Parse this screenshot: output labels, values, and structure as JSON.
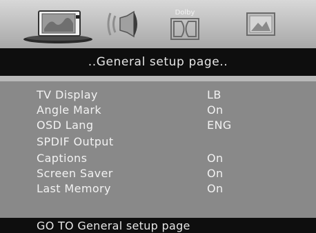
{
  "icons": {
    "setup": "setup-monitor-icon",
    "audio": "speaker-icon",
    "dolby": "dolby-icon",
    "video": "picture-icon",
    "dolby_label": "Dolby"
  },
  "header": {
    "title": "..General setup page.."
  },
  "menu": {
    "items": [
      {
        "label": "TV Display",
        "value": "LB"
      },
      {
        "label": "Angle Mark",
        "value": "On"
      },
      {
        "label": "OSD Lang",
        "value": "ENG"
      },
      {
        "label": "SPDIF Output",
        "value": ""
      },
      {
        "label": "Captions",
        "value": "On"
      },
      {
        "label": "Screen Saver",
        "value": "On"
      },
      {
        "label": "Last Memory",
        "value": "On"
      }
    ]
  },
  "footer": {
    "hint": "GO TO General setup page"
  }
}
